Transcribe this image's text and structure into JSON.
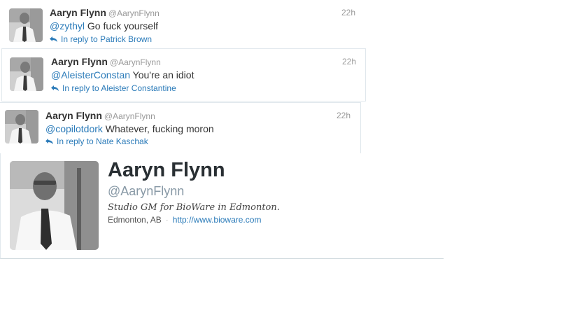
{
  "tweets": [
    {
      "name": "Aaryn Flynn",
      "handle": "@AarynFlynn",
      "time": "22h",
      "mention": "@zythyl",
      "body": " Go fuck yourself",
      "reply_to": "In reply to Patrick Brown"
    },
    {
      "name": "Aaryn Flynn",
      "handle": "@AarynFlynn",
      "time": "22h",
      "mention": "@AleisterConstan",
      "body": " You're an idiot",
      "reply_to": "In reply to Aleister Constantine"
    },
    {
      "name": "Aaryn Flynn",
      "handle": "@AarynFlynn",
      "time": "22h",
      "mention": "@copilotdork",
      "body": " Whatever, fucking moron",
      "reply_to": "In reply to Nate Kaschak"
    }
  ],
  "profile": {
    "name": "Aaryn Flynn",
    "handle": "@AarynFlynn",
    "bio": "Studio GM for BioWare in Edmonton.",
    "location": "Edmonton, AB",
    "separator": "·",
    "url": "http://www.bioware.com"
  },
  "colors": {
    "link": "#2b7bb9",
    "muted": "#999999",
    "text": "#333333"
  },
  "icons": {
    "reply": "reply-arrow-icon"
  }
}
